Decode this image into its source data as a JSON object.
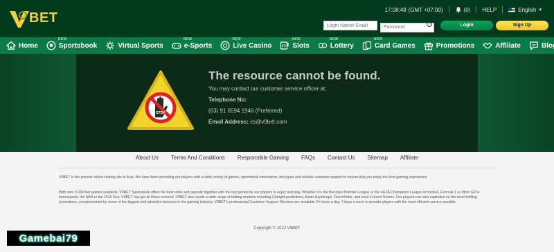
{
  "header": {
    "logo_text": "BET",
    "time": "17:08:48",
    "timezone": "(GMT +07:00)",
    "notification_count": "(0)",
    "help": "HELP",
    "language": "English",
    "login_placeholder": "Login Name/ Email",
    "password_placeholder": "Password",
    "login_button": "Login",
    "signup_button": "Sign Up"
  },
  "nav": {
    "items": [
      {
        "label": "Home",
        "icon": "home-icon",
        "new": ""
      },
      {
        "label": "Sportsbook",
        "icon": "soccer-ball-icon",
        "new": "NEW"
      },
      {
        "label": "Virtual Sports",
        "icon": "virtual-sports-icon",
        "new": ""
      },
      {
        "label": "e-Sports",
        "icon": "gamepad-icon",
        "new": "NEW"
      },
      {
        "label": "Live Casino",
        "icon": "casino-chip-icon",
        "new": "NEW"
      },
      {
        "label": "Slots",
        "icon": "slots-icon",
        "new": "NEW"
      },
      {
        "label": "Lottery",
        "icon": "lottery-icon",
        "new": "NEW"
      },
      {
        "label": "Card Games",
        "icon": "cards-icon",
        "new": "NEW"
      },
      {
        "label": "Promotions",
        "icon": "gift-icon",
        "new": ""
      },
      {
        "label": "Affiliate",
        "icon": "handshake-icon",
        "new": ""
      },
      {
        "label": "Blog",
        "icon": "chat-bubble-icon",
        "new": ""
      }
    ]
  },
  "error": {
    "title": "The resource cannot be found.",
    "subtitle": "You may contact our customer service officer at:",
    "telephone_label": "Telephone No:",
    "telephone_value": "(63) 91 6594 1946 (Preferred)",
    "email_label": "Email Address:",
    "email_value": "cs@v9bet.com",
    "stop_text": "STOP"
  },
  "footer": {
    "links": [
      "About Us",
      "Terms And Conditions",
      "Responsible Gaming",
      "FAQs",
      "Contact Us",
      "Sitemap",
      "Affiliate"
    ],
    "para1": "V9BET is the premier online betting site in Asia. We have been providing our players with a wide variety of games, sportsbook information, bet types and reliable customer support to ensure that you enjoy the best gaming experience.",
    "para2": "With over 5,000 live games available, V9BET Sportsbook offers the best odds and payouts together with the top games for our players to enjoy and play. Whether it is the Barclays Premier League or the UEFA Champions League in football, Formula 1 or Moto GP in motorsports, the NBA or the PGA Tour, V9BET has got all these covered. V9BET also avails a wide range of betting markets including Outright predictions, Asian Handicaps, Over/Under, and even Correct Scores. Our players can also capitalize on the most thrilling promotions, complemented by some of the biggest and attractive bonuses in the gaming industry. V9BET's professional Customer Support Services are available 24 hours a day, 7 days a week to provide players with the most efficient service possible.",
    "copyright": "Copyright © 2022 V9BET"
  },
  "watermark": "Gamebai79",
  "colors": {
    "header_bg": "#013a1d",
    "nav_bg": "#0a7b46",
    "accent_yellow": "#f5d23a",
    "login_green": "#0aa35a"
  }
}
